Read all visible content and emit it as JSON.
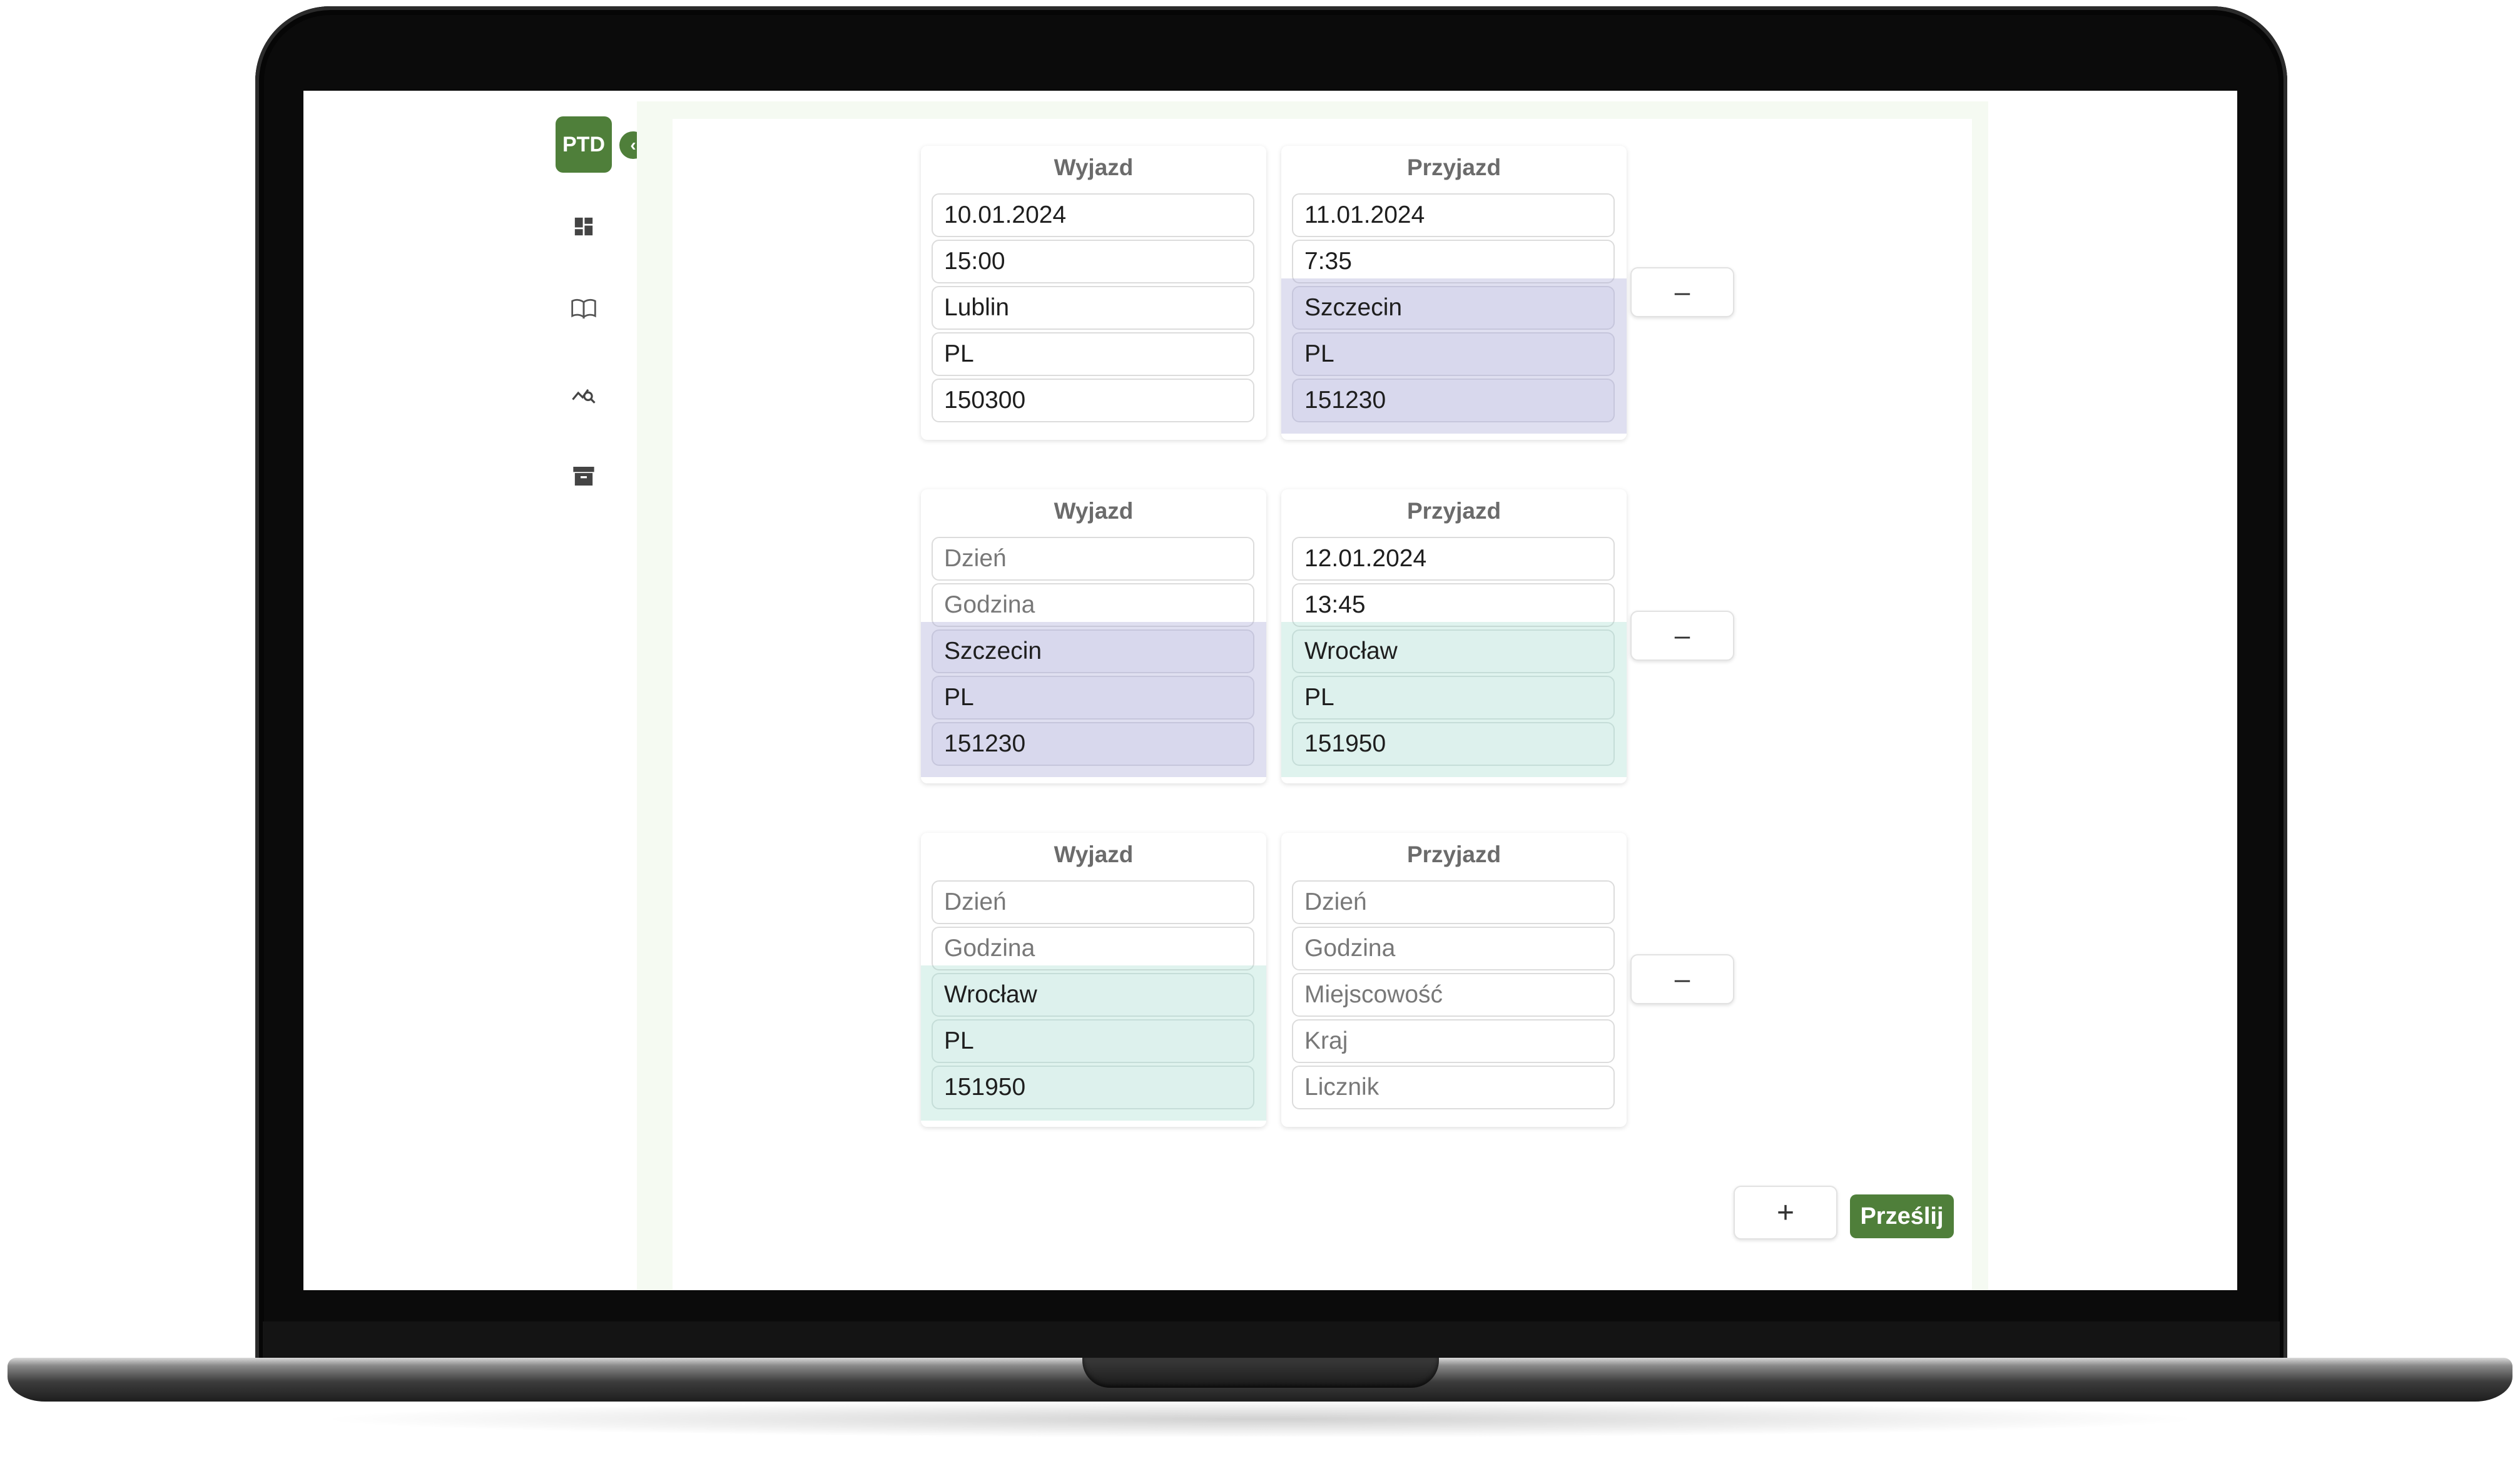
{
  "sidebar": {
    "brand": "PTD",
    "collapse_glyph": "‹",
    "items": [
      {
        "icon": "dashboard-icon"
      },
      {
        "icon": "book-icon"
      },
      {
        "icon": "chart-search-icon"
      },
      {
        "icon": "archive-icon"
      }
    ]
  },
  "trips": [
    {
      "departure": {
        "title": "Wyjazd",
        "day": "10.01.2024",
        "time": "15:00",
        "place": "Lublin",
        "country": "PL",
        "counter": "150300"
      },
      "arrival": {
        "title": "Przyjazd",
        "day": "11.01.2024",
        "time": "7:35",
        "place": "Szczecin",
        "country": "PL",
        "counter": "151230"
      },
      "remove_label": "–"
    },
    {
      "departure": {
        "title": "Wyjazd",
        "day": "Dzień",
        "time": "Godzina",
        "place": "Szczecin",
        "country": "PL",
        "counter": "151230"
      },
      "arrival": {
        "title": "Przyjazd",
        "day": "12.01.2024",
        "time": "13:45",
        "place": "Wrocław",
        "country": "PL",
        "counter": "151950"
      },
      "remove_label": "–"
    },
    {
      "departure": {
        "title": "Wyjazd",
        "day": "Dzień",
        "time": "Godzina",
        "place": "Wrocław",
        "country": "PL",
        "counter": "151950"
      },
      "arrival": {
        "title": "Przyjazd",
        "day": "Dzień",
        "time": "Godzina",
        "place": "Miejscowość",
        "country": "Kraj",
        "counter": "Licznik"
      },
      "remove_label": "–"
    }
  ],
  "actions": {
    "add_label": "+",
    "submit_label": "Prześlij"
  },
  "colors": {
    "brand": "#4f7f3a",
    "link_highlight_1": "#d5d5ea",
    "link_highlight_2": "#dcefeb"
  }
}
